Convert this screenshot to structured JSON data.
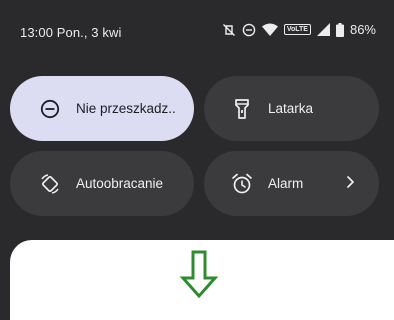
{
  "status_bar": {
    "time_date": "13:00 Pon., 3 kwi",
    "network_badge": "VoLTE",
    "battery": "86%",
    "icons": [
      "vibrate-off-icon",
      "dnd-icon",
      "wifi-icon",
      "volte-icon",
      "signal-icon",
      "battery-icon"
    ]
  },
  "tiles": {
    "dnd": {
      "label": "Nie przeszkadz..",
      "icon": "dnd-icon",
      "active": true
    },
    "torch": {
      "label": "Latarka",
      "icon": "flashlight-icon",
      "active": false
    },
    "rotate": {
      "label": "Autoobracanie",
      "icon": "auto-rotate-icon",
      "active": false
    },
    "alarm": {
      "label": "Alarm",
      "icon": "alarm-icon",
      "active": false
    }
  },
  "annotation": {
    "icon": "down-arrow-icon",
    "color": "#2e8b2e"
  },
  "colors": {
    "background": "#2a2a2c",
    "tile_inactive": "#3b3b3e",
    "tile_active": "#dcdcf2",
    "sheet": "#ffffff"
  }
}
